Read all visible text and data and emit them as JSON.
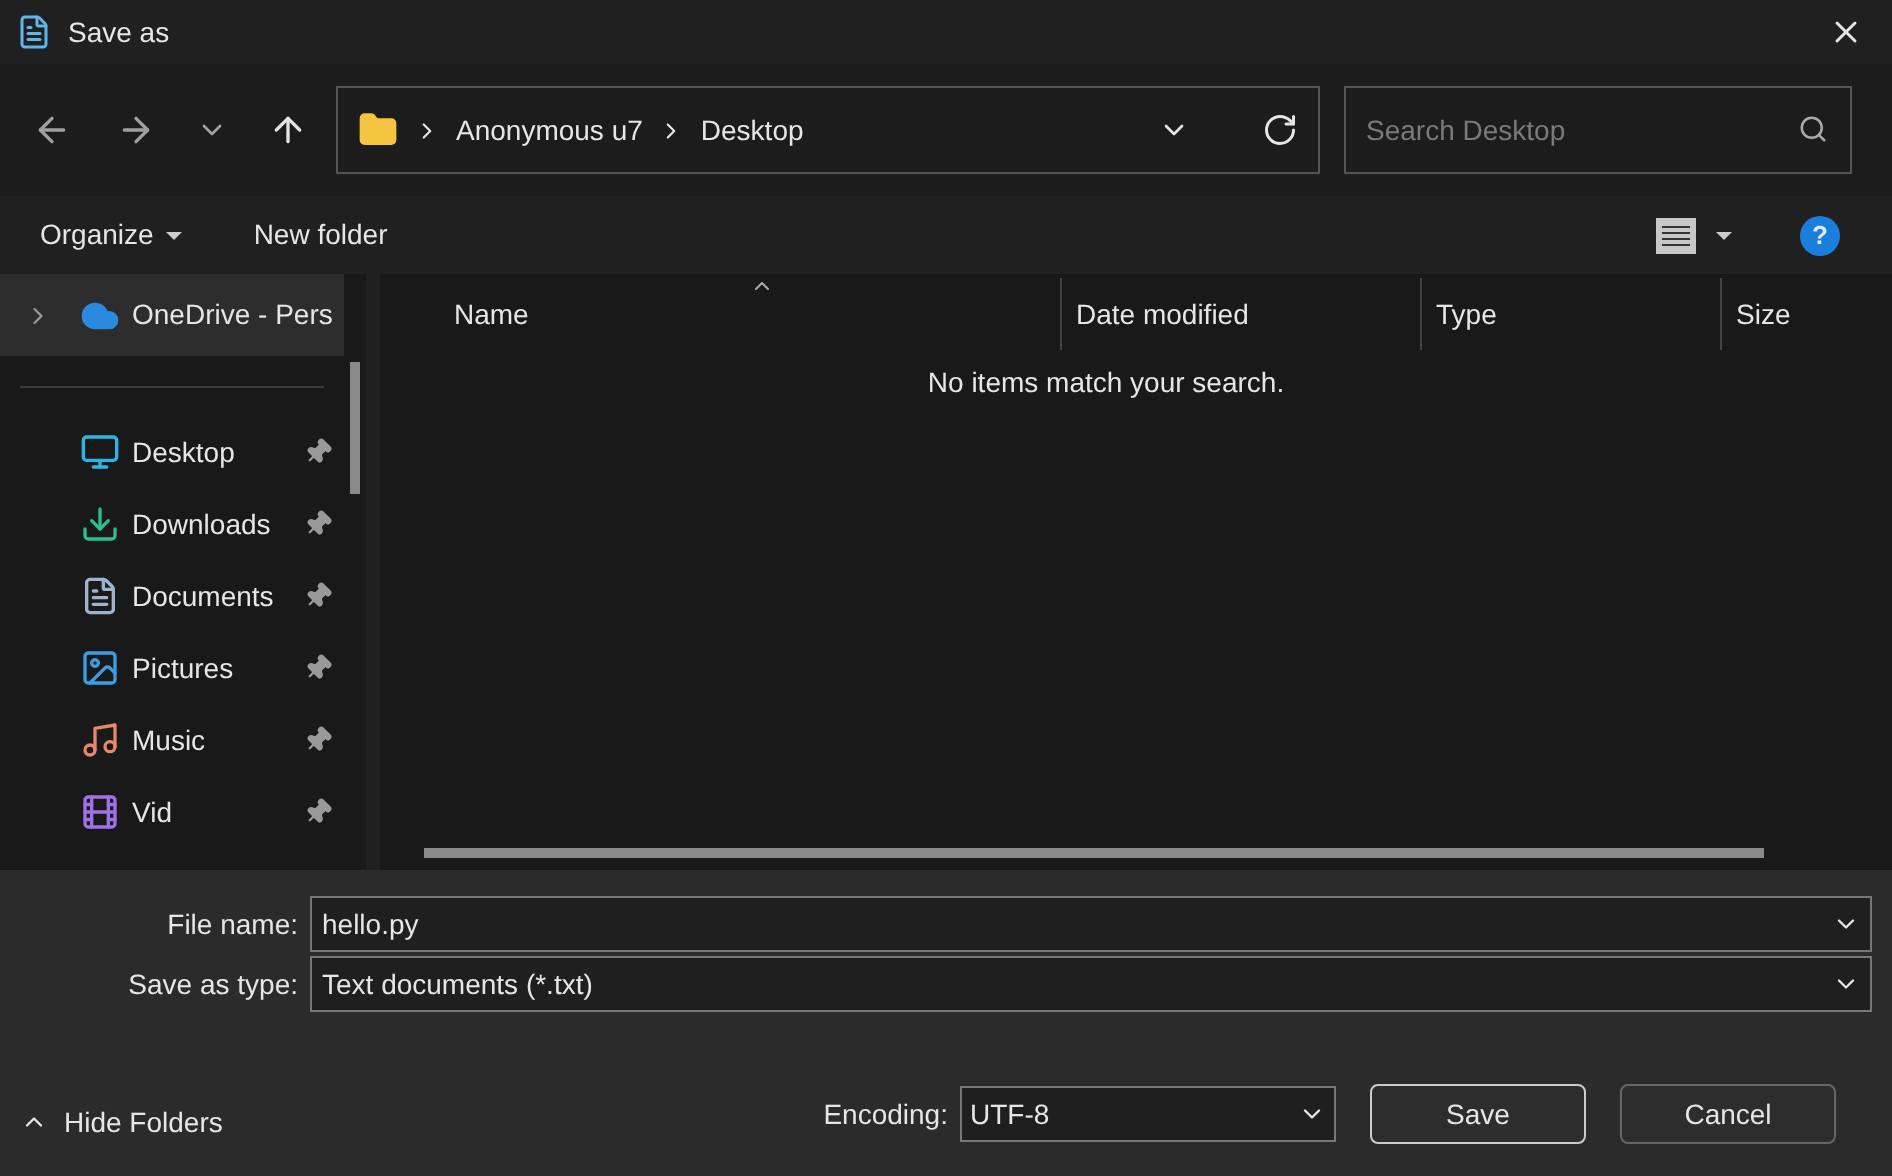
{
  "window": {
    "title": "Save as"
  },
  "address": {
    "crumbs": [
      "Anonymous u7",
      "Desktop"
    ]
  },
  "search": {
    "placeholder": "Search Desktop"
  },
  "toolbar": {
    "organize": "Organize",
    "new_folder": "New folder",
    "help": "?"
  },
  "sidebar": {
    "items": [
      {
        "kind": "cloud",
        "label": "OneDrive - Pers",
        "pinned": false,
        "selected": true
      },
      {
        "kind": "desktop",
        "label": "Desktop",
        "pinned": true,
        "selected": false
      },
      {
        "kind": "downloads",
        "label": "Downloads",
        "pinned": true,
        "selected": false
      },
      {
        "kind": "documents",
        "label": "Documents",
        "pinned": true,
        "selected": false
      },
      {
        "kind": "pictures",
        "label": "Pictures",
        "pinned": true,
        "selected": false
      },
      {
        "kind": "music",
        "label": "Music",
        "pinned": true,
        "selected": false
      },
      {
        "kind": "videos",
        "label": "Vid",
        "pinned": true,
        "selected": false
      }
    ]
  },
  "table": {
    "columns": [
      {
        "label": "Name",
        "sorted": true
      },
      {
        "label": "Date modified",
        "sorted": false
      },
      {
        "label": "Type",
        "sorted": false
      },
      {
        "label": "Size",
        "sorted": false
      }
    ],
    "empty_message": "No items match your search."
  },
  "form": {
    "file_name_label": "File name:",
    "file_name": "hello.py",
    "type_label": "Save as type:",
    "type": "Text documents (*.txt)",
    "encoding_label": "Encoding:",
    "encoding": "UTF-8"
  },
  "hide_folders": "Hide Folders",
  "buttons": [
    "Save",
    "Cancel"
  ]
}
